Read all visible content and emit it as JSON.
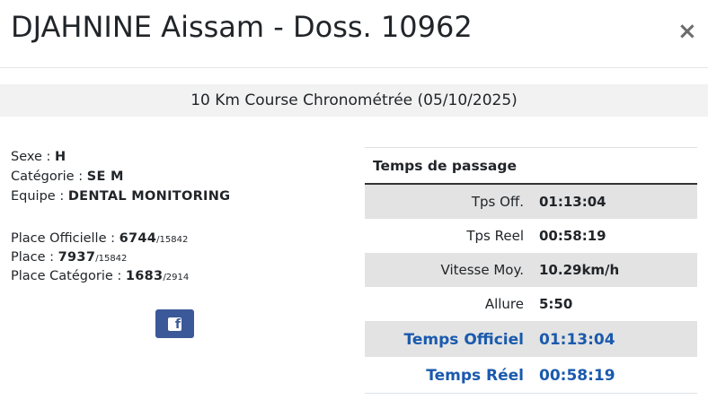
{
  "header": {
    "title": "DJAHNINE Aissam - Doss. 10962",
    "close_label": "×"
  },
  "event": "10 Km Course Chronométrée (05/10/2025)",
  "athlete": {
    "sexe_label": "Sexe : ",
    "sexe": "H",
    "categorie_label": "Catégorie : ",
    "categorie": "SE M",
    "equipe_label": "Equipe : ",
    "equipe": "DENTAL MONITORING",
    "place_officielle_label": "Place Officielle : ",
    "place_officielle": "6744",
    "place_officielle_total": "/15842",
    "place_label": "Place : ",
    "place": "7937",
    "place_total": "/15842",
    "place_categorie_label": "Place Catégorie : ",
    "place_categorie": "1683",
    "place_categorie_total": "/2914"
  },
  "share": {
    "facebook_glyph": "f",
    "icon": "facebook-icon",
    "color": "#3b5998"
  },
  "splits": {
    "header": "Temps de passage",
    "rows": [
      {
        "label": "Tps Off.",
        "value": "01:13:04"
      },
      {
        "label": "Tps Reel",
        "value": "00:58:19"
      },
      {
        "label": "Vitesse Moy.",
        "value": "10.29km/h"
      },
      {
        "label": "Allure",
        "value": "5:50"
      },
      {
        "label": "Temps Officiel",
        "value": "01:13:04"
      },
      {
        "label": "Temps Réel",
        "value": "00:58:19"
      }
    ]
  },
  "colors": {
    "highlight": "#1a5aad",
    "row_alt": "#e3e3e3"
  }
}
